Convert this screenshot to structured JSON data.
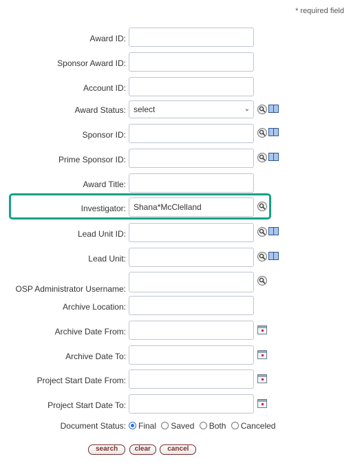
{
  "required_note": "* required field",
  "fields": {
    "award_id": {
      "label": "Award ID:",
      "value": ""
    },
    "sponsor_award_id": {
      "label": "Sponsor Award ID:",
      "value": ""
    },
    "account_id": {
      "label": "Account ID:",
      "value": ""
    },
    "award_status": {
      "label": "Award Status:",
      "value": "select"
    },
    "sponsor_id": {
      "label": "Sponsor ID:",
      "value": ""
    },
    "prime_sponsor_id": {
      "label": "Prime Sponsor ID:",
      "value": ""
    },
    "award_title": {
      "label": "Award Title:",
      "value": ""
    },
    "investigator": {
      "label": "Investigator:",
      "value": "Shana*McClelland"
    },
    "lead_unit_id": {
      "label": "Lead Unit ID:",
      "value": ""
    },
    "lead_unit": {
      "label": "Lead Unit:",
      "value": ""
    },
    "osp_admin": {
      "label": "OSP Administrator Username:",
      "value": ""
    },
    "archive_location": {
      "label": "Archive Location:",
      "value": ""
    },
    "archive_date_from": {
      "label": "Archive Date From:",
      "value": ""
    },
    "archive_date_to": {
      "label": "Archive Date To:",
      "value": ""
    },
    "project_start_from": {
      "label": "Project Start Date From:",
      "value": ""
    },
    "project_start_to": {
      "label": "Project Start Date To:",
      "value": ""
    }
  },
  "document_status": {
    "label": "Document Status:",
    "options": [
      "Final",
      "Saved",
      "Both",
      "Canceled"
    ],
    "selected": "Final"
  },
  "buttons": {
    "search": "search",
    "clear": "clear",
    "cancel": "cancel"
  },
  "icons": {
    "lookup": "magnifier-icon",
    "directory": "book-icon",
    "calendar": "calendar-icon"
  },
  "colors": {
    "highlight": "#16a184",
    "button_text": "#7a2b2b"
  }
}
